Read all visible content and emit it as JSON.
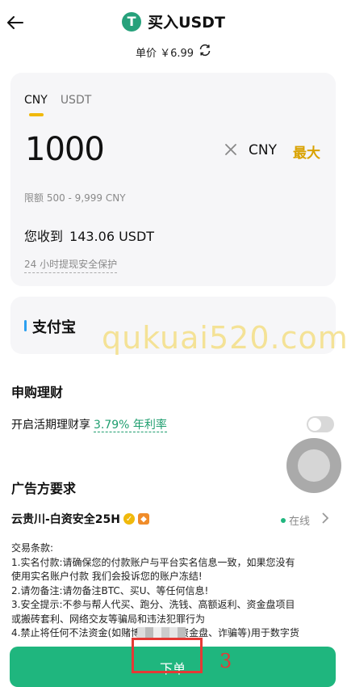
{
  "header": {
    "title": "买入USDT",
    "logo_letter": "T",
    "price_label": "单价 ￥6.99"
  },
  "amount_card": {
    "tabs": [
      "CNY",
      "USDT"
    ],
    "amount": "1000",
    "currency": "CNY",
    "max_label": "最大",
    "limit_text": "限额 500 - 9,999 CNY",
    "receive_label": "您收到",
    "receive_value": "143.06 USDT",
    "protect_text": "24 小时提现安全保护"
  },
  "payment": {
    "method": "支付宝",
    "bar_color": "#2ca0f0"
  },
  "watermark": "qukuai520.com",
  "savings": {
    "title": "申购理财",
    "row_label": "开启活期理财享",
    "apr": "3.79% 年利率"
  },
  "advertiser": {
    "section_title": "广告方要求",
    "name": "云贵川-白资安全25H",
    "status": "在线",
    "terms": [
      "交易条款:",
      "1.实名付款:请确保您的付款账户与平台实名信息一致，如果您没有",
      "使用实名账户付款 我们会投诉您的账户冻结!",
      "2.请勿备注:请勿备注BTC、买U、等任何信息!",
      "3.安全提示:不参与帮人代买、跑分、洗钱、高额返利、资金盘项目",
      "或搬砖套利、网络交友等骗局和违法犯罪行为",
      "4.禁止将任何不法资金(如赌博、跑分、资金盘、诈骗等)用于数字货"
    ]
  },
  "footer": {
    "button_label": "下单",
    "annotation": "3"
  },
  "colors": {
    "accent": "#f0b90b",
    "primary": "#1fb67e"
  }
}
